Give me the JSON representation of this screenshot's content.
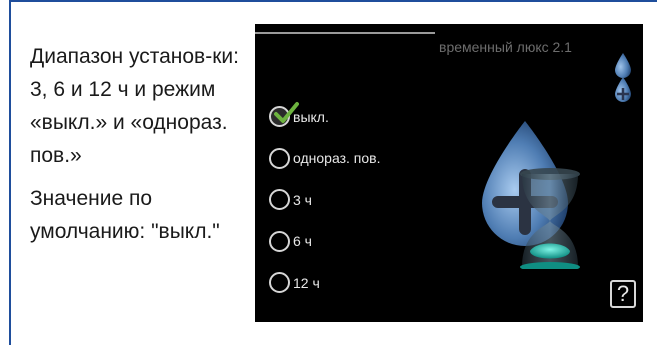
{
  "description": {
    "range_text": "Диапазон установ-ки: 3, 6 и 12 ч и режим «выкл.» и «однораз. пов.»",
    "default_text": "Значение по умолчанию: \"выкл.\""
  },
  "screen": {
    "title": "временный люкс 2.1",
    "options": [
      {
        "label": "выкл.",
        "checked": true
      },
      {
        "label": "однораз. пов.",
        "checked": false
      },
      {
        "label": "3 ч",
        "checked": false
      },
      {
        "label": "6 ч",
        "checked": false
      },
      {
        "label": "12 ч",
        "checked": false
      }
    ],
    "help_label": "?",
    "icons": [
      "water-drop-icon",
      "water-drop-icon",
      "hot-water-timer-icon",
      "checkmark-icon",
      "help-icon"
    ],
    "colors": {
      "accent_check": "#6db33f",
      "drop_blue": "#4f7db3",
      "hourglass_teal": "#22c3b2",
      "frame_blue": "#1f4e9c"
    }
  }
}
